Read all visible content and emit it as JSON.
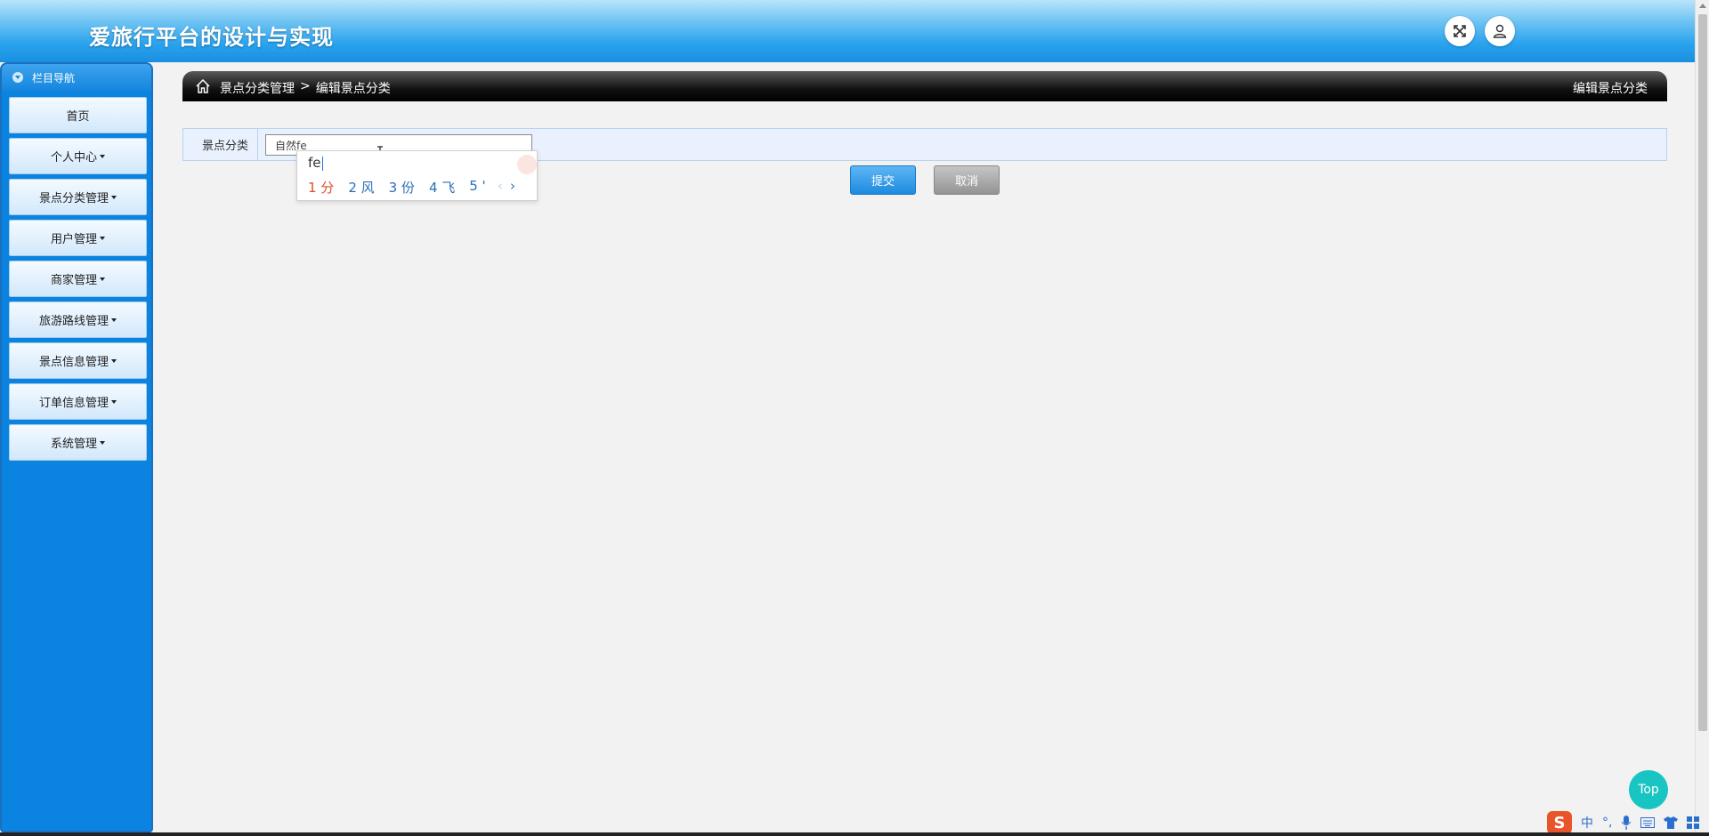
{
  "header": {
    "title": "爱旅行平台的设计与实现",
    "fullscreen_icon": "expand-arrows-icon",
    "user_icon": "user-icon"
  },
  "sidebar": {
    "heading": "栏目导航",
    "items": [
      {
        "label": "首页",
        "has_caret": false
      },
      {
        "label": "个人中心",
        "has_caret": true
      },
      {
        "label": "景点分类管理",
        "has_caret": true
      },
      {
        "label": "用户管理",
        "has_caret": true
      },
      {
        "label": "商家管理",
        "has_caret": true
      },
      {
        "label": "旅游路线管理",
        "has_caret": true
      },
      {
        "label": "景点信息管理",
        "has_caret": true
      },
      {
        "label": "订单信息管理",
        "has_caret": true
      },
      {
        "label": "系统管理",
        "has_caret": true
      }
    ]
  },
  "breadcrumb": {
    "section": "景点分类管理",
    "separator": ">",
    "page": "编辑景点分类",
    "right_title": "编辑景点分类"
  },
  "form": {
    "field_label": "景点分类",
    "field_value": "自然fe",
    "submit_label": "提交",
    "cancel_label": "取消"
  },
  "ime": {
    "typed": "fe",
    "candidates": [
      "1 分",
      "2 风",
      "3 份",
      "4 飞",
      "5 '"
    ],
    "prev": "‹",
    "next": "›",
    "tray": {
      "logo": "S",
      "mode": "中",
      "punct": "°,",
      "mic_icon": "microphone-icon",
      "keyboard_icon": "keyboard-icon",
      "skin_icon": "shirt-icon",
      "apps_icon": "grid-icon"
    }
  },
  "top_button": "Top",
  "colors": {
    "sidebar_bg": "#0a84e0",
    "submit": "#1d8ae0",
    "cancel": "#949494",
    "top_button": "#18c5c2"
  }
}
